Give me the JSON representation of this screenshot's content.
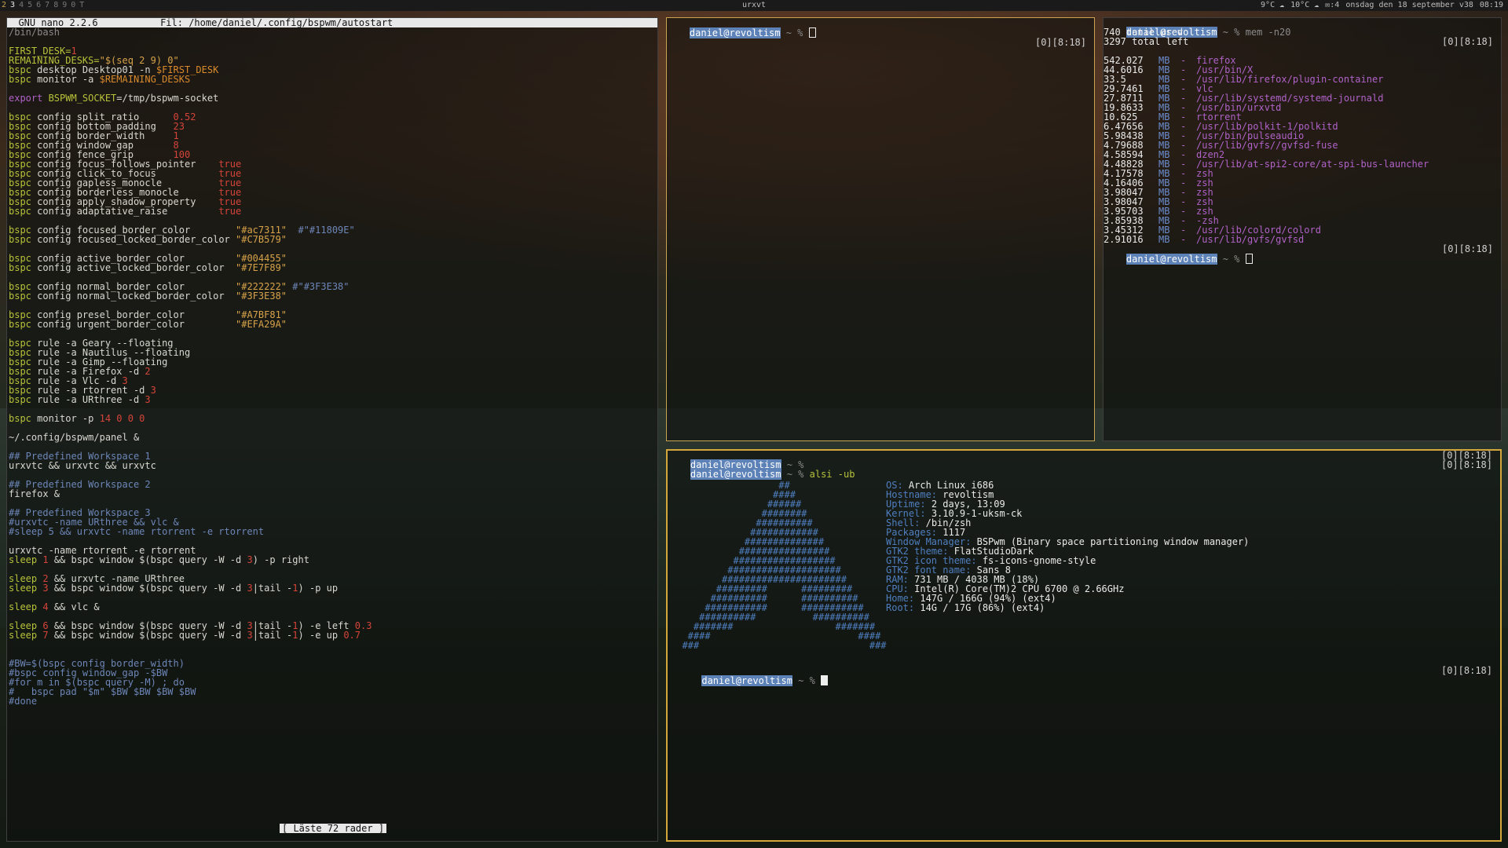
{
  "panel": {
    "workspaces": [
      "2",
      "3",
      "4",
      "5",
      "6",
      "7",
      "8",
      "9",
      "0",
      "T"
    ],
    "window_title": "urxvt",
    "status": [
      "9°C ☁",
      "10°C ☁",
      "✉:4",
      "onsdag den 18 september v38",
      "08:19"
    ]
  },
  "nano": {
    "header": "  GNU nano 2.2.6           Fil: /home/daniel/.config/bspwm/autostart                                                     ",
    "message": "[ Läste 72 rader ]",
    "lines": [
      [
        [
          "/bin/bash",
          "c-dim"
        ]
      ],
      [
        [
          "",
          ""
        ]
      ],
      [
        [
          "FIRST_DESK=",
          "c-grn"
        ],
        [
          "1",
          "c-red"
        ]
      ],
      [
        [
          "REMAINING_DESKS=",
          "c-grn"
        ],
        [
          "\"$(seq 2 9) 0\"",
          "c-str"
        ]
      ],
      [
        [
          "bspc",
          "c-grn"
        ],
        [
          " desktop Desktop01 -n ",
          ""
        ],
        [
          "$FIRST_DESK",
          "c-org"
        ]
      ],
      [
        [
          "bspc",
          "c-grn"
        ],
        [
          " monitor -a ",
          ""
        ],
        [
          "$REMAINING_DESKS",
          "c-org"
        ]
      ],
      [
        [
          "",
          ""
        ]
      ],
      [
        [
          "export ",
          "c-mag"
        ],
        [
          "BSPWM_SOCKET",
          "c-grn"
        ],
        [
          "=/tmp/bspwm-socket",
          ""
        ]
      ],
      [
        [
          "",
          ""
        ]
      ],
      [
        [
          "bspc",
          "c-grn"
        ],
        [
          " config split_ratio      ",
          ""
        ],
        [
          "0.52",
          "c-red"
        ]
      ],
      [
        [
          "bspc",
          "c-grn"
        ],
        [
          " config bottom_padding   ",
          ""
        ],
        [
          "23",
          "c-red"
        ]
      ],
      [
        [
          "bspc",
          "c-grn"
        ],
        [
          " config border_width     ",
          ""
        ],
        [
          "1",
          "c-red"
        ]
      ],
      [
        [
          "bspc",
          "c-grn"
        ],
        [
          " config window_gap       ",
          ""
        ],
        [
          "8",
          "c-red"
        ]
      ],
      [
        [
          "bspc",
          "c-grn"
        ],
        [
          " config fence_grip       ",
          ""
        ],
        [
          "100",
          "c-red"
        ]
      ],
      [
        [
          "bspc",
          "c-grn"
        ],
        [
          " config focus_follows_pointer    ",
          ""
        ],
        [
          "true",
          "c-red"
        ]
      ],
      [
        [
          "bspc",
          "c-grn"
        ],
        [
          " config click_to_focus           ",
          ""
        ],
        [
          "true",
          "c-red"
        ]
      ],
      [
        [
          "bspc",
          "c-grn"
        ],
        [
          " config gapless_monocle          ",
          ""
        ],
        [
          "true",
          "c-red"
        ]
      ],
      [
        [
          "bspc",
          "c-grn"
        ],
        [
          " config borderless_monocle       ",
          ""
        ],
        [
          "true",
          "c-red"
        ]
      ],
      [
        [
          "bspc",
          "c-grn"
        ],
        [
          " config apply_shadow_property    ",
          ""
        ],
        [
          "true",
          "c-red"
        ]
      ],
      [
        [
          "bspc",
          "c-grn"
        ],
        [
          " config adaptative_raise         ",
          ""
        ],
        [
          "true",
          "c-red"
        ]
      ],
      [
        [
          "",
          ""
        ]
      ],
      [
        [
          "bspc",
          "c-grn"
        ],
        [
          " config focused_border_color        ",
          ""
        ],
        [
          "\"#ac7311\"",
          "c-str"
        ],
        [
          "  #\"#11809E\"",
          "c-cmt"
        ]
      ],
      [
        [
          "bspc",
          "c-grn"
        ],
        [
          " config focused_locked_border_color ",
          ""
        ],
        [
          "\"#C7B579\"",
          "c-str"
        ]
      ],
      [
        [
          "",
          ""
        ]
      ],
      [
        [
          "bspc",
          "c-grn"
        ],
        [
          " config active_border_color         ",
          ""
        ],
        [
          "\"#004455\"",
          "c-str"
        ]
      ],
      [
        [
          "bspc",
          "c-grn"
        ],
        [
          " config active_locked_border_color  ",
          ""
        ],
        [
          "\"#7E7F89\"",
          "c-str"
        ]
      ],
      [
        [
          "",
          ""
        ]
      ],
      [
        [
          "bspc",
          "c-grn"
        ],
        [
          " config normal_border_color         ",
          ""
        ],
        [
          "\"#222222\"",
          "c-str"
        ],
        [
          " #\"#3F3E38\"",
          "c-cmt"
        ]
      ],
      [
        [
          "bspc",
          "c-grn"
        ],
        [
          " config normal_locked_border_color  ",
          ""
        ],
        [
          "\"#3F3E38\"",
          "c-str"
        ]
      ],
      [
        [
          "",
          ""
        ]
      ],
      [
        [
          "bspc",
          "c-grn"
        ],
        [
          " config presel_border_color         ",
          ""
        ],
        [
          "\"#A7BF81\"",
          "c-str"
        ]
      ],
      [
        [
          "bspc",
          "c-grn"
        ],
        [
          " config urgent_border_color         ",
          ""
        ],
        [
          "\"#EFA29A\"",
          "c-str"
        ]
      ],
      [
        [
          "",
          ""
        ]
      ],
      [
        [
          "bspc",
          "c-grn"
        ],
        [
          " rule -a Geary --floating",
          ""
        ]
      ],
      [
        [
          "bspc",
          "c-grn"
        ],
        [
          " rule -a Nautilus --floating",
          ""
        ]
      ],
      [
        [
          "bspc",
          "c-grn"
        ],
        [
          " rule -a Gimp --floating",
          ""
        ]
      ],
      [
        [
          "bspc",
          "c-grn"
        ],
        [
          " rule -a Firefox -d ",
          ""
        ],
        [
          "2",
          "c-red"
        ]
      ],
      [
        [
          "bspc",
          "c-grn"
        ],
        [
          " rule -a Vlc -d ",
          ""
        ],
        [
          "3",
          "c-red"
        ]
      ],
      [
        [
          "bspc",
          "c-grn"
        ],
        [
          " rule -a rtorrent -d ",
          ""
        ],
        [
          "3",
          "c-red"
        ]
      ],
      [
        [
          "bspc",
          "c-grn"
        ],
        [
          " rule -a URthree -d ",
          ""
        ],
        [
          "3",
          "c-red"
        ]
      ],
      [
        [
          "",
          ""
        ]
      ],
      [
        [
          "bspc",
          "c-grn"
        ],
        [
          " monitor -p ",
          ""
        ],
        [
          "14 0 0 0",
          "c-red"
        ]
      ],
      [
        [
          "",
          ""
        ]
      ],
      [
        [
          "~/.config/bspwm/panel &",
          ""
        ]
      ],
      [
        [
          "",
          ""
        ]
      ],
      [
        [
          "## Predefined Workspace 1",
          "c-cmt"
        ]
      ],
      [
        [
          "urxvtc && urxvtc && urxvtc",
          ""
        ]
      ],
      [
        [
          "",
          ""
        ]
      ],
      [
        [
          "## Predefined Workspace 2",
          "c-cmt"
        ]
      ],
      [
        [
          "firefox &",
          ""
        ]
      ],
      [
        [
          "",
          ""
        ]
      ],
      [
        [
          "## Predefined Workspace 3",
          "c-cmt"
        ]
      ],
      [
        [
          "#urxvtc -name URthree && vlc &",
          "c-cmt"
        ]
      ],
      [
        [
          "#sleep 5 && urxvtc -name rtorrent -e rtorrent",
          "c-cmt"
        ]
      ],
      [
        [
          "",
          ""
        ]
      ],
      [
        [
          "urxvtc -name rtorrent -e rtorrent",
          ""
        ]
      ],
      [
        [
          "sleep ",
          "c-grn"
        ],
        [
          "1",
          "c-red"
        ],
        [
          " && bspc window $(bspc query -W -d ",
          ""
        ],
        [
          "3",
          "c-red"
        ],
        [
          ") -p right",
          ""
        ]
      ],
      [
        [
          "",
          ""
        ]
      ],
      [
        [
          "sleep ",
          "c-grn"
        ],
        [
          "2",
          "c-red"
        ],
        [
          " && urxvtc -name URthree",
          ""
        ]
      ],
      [
        [
          "sleep ",
          "c-grn"
        ],
        [
          "3",
          "c-red"
        ],
        [
          " && bspc window $(bspc query -W -d ",
          ""
        ],
        [
          "3",
          "c-red"
        ],
        [
          "|tail -",
          ""
        ],
        [
          "1",
          "c-red"
        ],
        [
          ") -p up",
          ""
        ]
      ],
      [
        [
          "",
          ""
        ]
      ],
      [
        [
          "sleep ",
          "c-grn"
        ],
        [
          "4",
          "c-red"
        ],
        [
          " && vlc &",
          ""
        ]
      ],
      [
        [
          "",
          ""
        ]
      ],
      [
        [
          "sleep ",
          "c-grn"
        ],
        [
          "6",
          "c-red"
        ],
        [
          " && bspc window $(bspc query -W -d ",
          ""
        ],
        [
          "3",
          "c-red"
        ],
        [
          "|tail -",
          ""
        ],
        [
          "1",
          "c-red"
        ],
        [
          ") -e left ",
          ""
        ],
        [
          "0.3",
          "c-red"
        ]
      ],
      [
        [
          "sleep ",
          "c-grn"
        ],
        [
          "7",
          "c-red"
        ],
        [
          " && bspc window $(bspc query -W -d ",
          ""
        ],
        [
          "3",
          "c-red"
        ],
        [
          "|tail -",
          ""
        ],
        [
          "1",
          "c-red"
        ],
        [
          ") -e up ",
          ""
        ],
        [
          "0.7",
          "c-red"
        ]
      ],
      [
        [
          "",
          ""
        ]
      ],
      [
        [
          "",
          ""
        ]
      ],
      [
        [
          "#BW=$(bspc config border_width)",
          "c-cmt"
        ]
      ],
      [
        [
          "#bspc config window_gap -$BW",
          "c-cmt"
        ]
      ],
      [
        [
          "#for m in $(bspc query -M) ; do",
          "c-cmt"
        ]
      ],
      [
        [
          "#   bspc pad \"$m\" $BW $BW $BW $BW",
          "c-cmt"
        ]
      ],
      [
        [
          "#done",
          "c-cmt"
        ]
      ]
    ]
  },
  "term_top": {
    "prompt_user": "daniel@revoltism",
    "prompt_rest": " ~ % ",
    "right": "[0][8:18]"
  },
  "term_mem": {
    "prompt_user": "daniel@revoltism",
    "command": " ~ % mem -n20",
    "right": "[0][8:18]",
    "used": "740 total used",
    "left": "3297 total left",
    "rows": [
      [
        "542.027",
        "MB",
        "-",
        "firefox"
      ],
      [
        "44.6016",
        "MB",
        "-",
        "/usr/bin/X"
      ],
      [
        "33.5",
        "MB",
        "-",
        "/usr/lib/firefox/plugin-container"
      ],
      [
        "29.7461",
        "MB",
        "-",
        "vlc"
      ],
      [
        "27.8711",
        "MB",
        "-",
        "/usr/lib/systemd/systemd-journald"
      ],
      [
        "19.8633",
        "MB",
        "-",
        "/usr/bin/urxvtd"
      ],
      [
        "10.625",
        "MB",
        "-",
        "rtorrent"
      ],
      [
        "6.47656",
        "MB",
        "-",
        "/usr/lib/polkit-1/polkitd"
      ],
      [
        "5.98438",
        "MB",
        "-",
        "/usr/bin/pulseaudio"
      ],
      [
        "4.79688",
        "MB",
        "-",
        "/usr/lib/gvfs//gvfsd-fuse"
      ],
      [
        "4.58594",
        "MB",
        "-",
        "dzen2"
      ],
      [
        "4.48828",
        "MB",
        "-",
        "/usr/lib/at-spi2-core/at-spi-bus-launcher"
      ],
      [
        "4.17578",
        "MB",
        "-",
        "zsh"
      ],
      [
        "4.16406",
        "MB",
        "-",
        "zsh"
      ],
      [
        "3.98047",
        "MB",
        "-",
        "zsh"
      ],
      [
        "3.98047",
        "MB",
        "-",
        "zsh"
      ],
      [
        "3.95703",
        "MB",
        "-",
        "zsh"
      ],
      [
        "3.85938",
        "MB",
        "-",
        "-zsh"
      ],
      [
        "3.45312",
        "MB",
        "-",
        "/usr/lib/colord/colord"
      ],
      [
        "2.91016",
        "MB",
        "-",
        "/usr/lib/gvfs/gvfsd"
      ]
    ],
    "prompt2_rest": " ~ % ",
    "right2": "[0][8:18]"
  },
  "term_alsi": {
    "prompt_user": "daniel@revoltism",
    "line1_rest": " ~ %",
    "line2_rest": " ~ % ",
    "line2_cmd": "alsi -ub",
    "right1": "[0][8:18]",
    "right2": "[0][8:18]",
    "logo": [
      "                   ##",
      "                  ####",
      "                 ######",
      "                ########",
      "               ##########",
      "              ############",
      "             ##############",
      "            ################",
      "           ##################",
      "          ####################",
      "         ######################",
      "        #########      #########",
      "       ##########      ##########",
      "      ###########      ###########",
      "     ##########          ##########",
      "    #######                  #######",
      "   ####                          ####",
      "  ###                              ###"
    ],
    "info": [
      [
        "OS:",
        "Arch Linux i686",
        []
      ],
      [
        "Hostname:",
        "revoltism",
        []
      ],
      [
        "Uptime:",
        "2 days, 13:09",
        []
      ],
      [
        "Kernel:",
        "3.10.9-1-uksm-ck",
        []
      ],
      [
        "Shell:",
        "/bin/zsh",
        []
      ],
      [
        "Packages:",
        "1117",
        []
      ],
      [
        "Window Manager:",
        "BSPwm (Binary space partitioning window manager)",
        []
      ],
      [
        "GTK2 theme:",
        "FlatStudioDark",
        []
      ],
      [
        "GTK2 icon theme:",
        "fs-icons-gnome-style",
        []
      ],
      [
        "GTK2 font name:",
        "Sans 8",
        []
      ],
      [
        "RAM:",
        "731 MB / 4038 MB (18%)",
        []
      ],
      [
        "CPU:",
        "Intel(R) Core(TM)2 CPU 6700 @ 2.66GHz",
        []
      ],
      [
        "Home:",
        "147G / 166G (94%) (ext4)",
        []
      ],
      [
        "Root:",
        "14G / 17G (86%) (ext4)",
        []
      ]
    ],
    "prompt3_rest": " ~ % ",
    "right3": "[0][8:18]"
  }
}
